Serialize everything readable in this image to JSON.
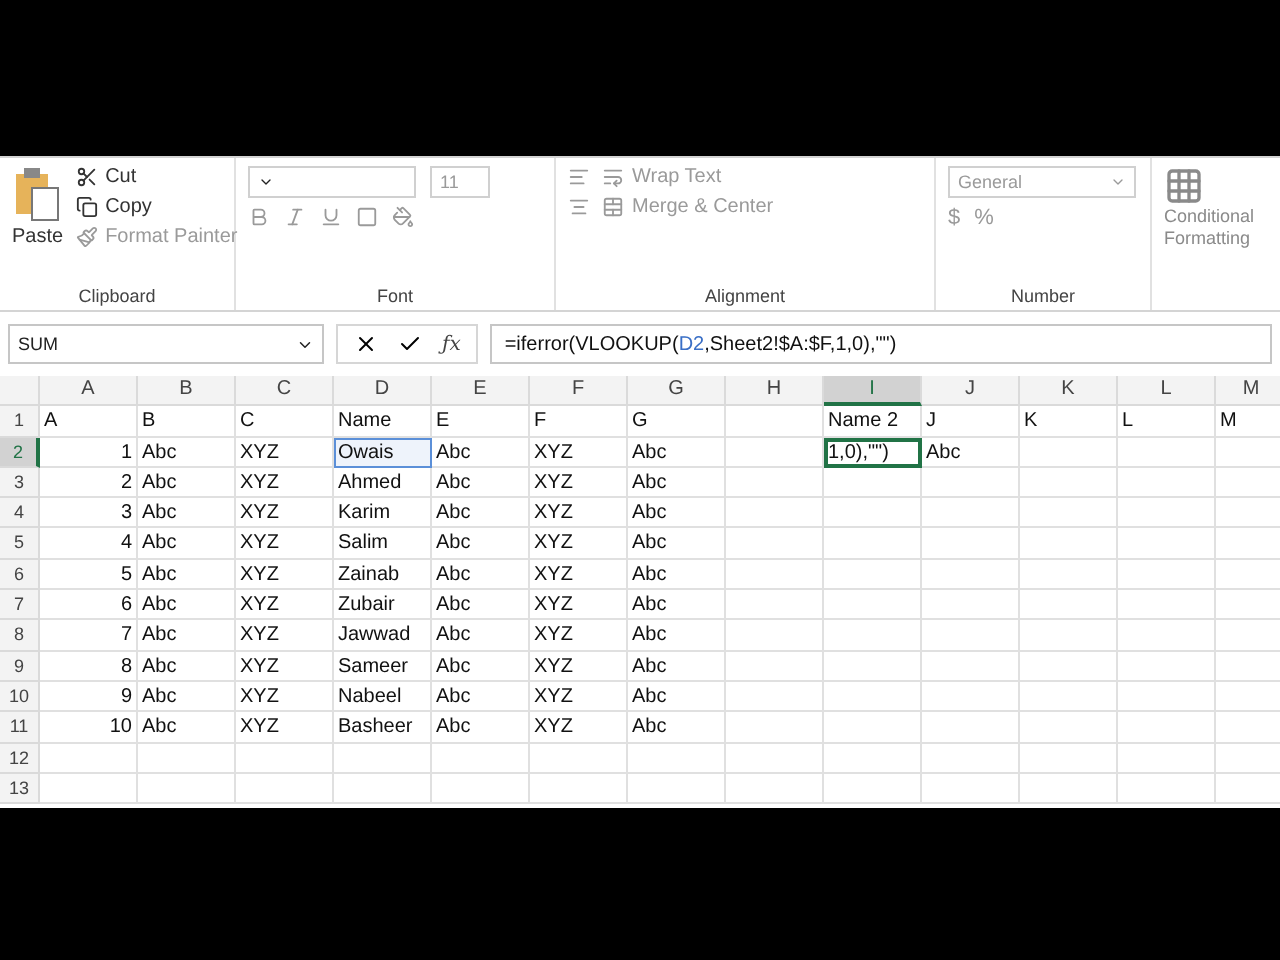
{
  "ribbon": {
    "groups": [
      {
        "kind": "clipboard",
        "label": "Clipboard",
        "paste": {
          "label": "Paste",
          "disabled": false
        },
        "items": [
          {
            "label": "Cut",
            "disabled": false
          },
          {
            "label": "Copy",
            "disabled": false
          },
          {
            "label": "Format Painter",
            "disabled": true
          }
        ]
      },
      {
        "kind": "font",
        "label": "Font",
        "font_size": "11",
        "disabled": true
      },
      {
        "kind": "alignment",
        "label": "Alignment",
        "items": [
          {
            "label": "Wrap Text",
            "disabled": true
          },
          {
            "label": "Merge & Center",
            "disabled": true
          }
        ]
      },
      {
        "kind": "number",
        "label": "Number",
        "format": "General",
        "symbols": [
          "$",
          "%"
        ],
        "disabled": true
      },
      {
        "kind": "styles",
        "items": [
          {
            "label": "Conditional"
          },
          {
            "label": "Formatting"
          }
        ]
      }
    ]
  },
  "formula_bar": {
    "name_box": "SUM",
    "function_symbol": "ƒx",
    "formula": [
      {
        "text": "=iferror(VLOOKUP(",
        "kind": "plain"
      },
      {
        "text": "D2",
        "kind": "ref"
      },
      {
        "text": ",Sheet2!$A:$F,1,0),\"\")",
        "kind": "plain"
      }
    ]
  },
  "sheet": {
    "columns": [
      {
        "label": "A",
        "selected": false
      },
      {
        "label": "B",
        "selected": false
      },
      {
        "label": "C",
        "selected": false
      },
      {
        "label": "D",
        "selected": false
      },
      {
        "label": "E",
        "selected": false
      },
      {
        "label": "F",
        "selected": false
      },
      {
        "label": "G",
        "selected": false
      },
      {
        "label": "H",
        "selected": false
      },
      {
        "label": "I",
        "selected": true
      },
      {
        "label": "J",
        "selected": false
      },
      {
        "label": "K",
        "selected": false
      },
      {
        "label": "L",
        "selected": false
      },
      {
        "label": "M",
        "selected": false
      }
    ],
    "rows": [
      {
        "number": "1",
        "selected": false,
        "cells": [
          {
            "text": "A",
            "referenced": false,
            "editing": false
          },
          {
            "text": "B",
            "referenced": false,
            "editing": false
          },
          {
            "text": "C",
            "referenced": false,
            "editing": false
          },
          {
            "text": "Name",
            "referenced": false,
            "editing": false
          },
          {
            "text": "E",
            "referenced": false,
            "editing": false
          },
          {
            "text": "F",
            "referenced": false,
            "editing": false
          },
          {
            "text": "G",
            "referenced": false,
            "editing": false
          },
          {
            "text": "",
            "referenced": false,
            "editing": false
          },
          {
            "text": "Name 2",
            "referenced": false,
            "editing": false
          },
          {
            "text": "J",
            "referenced": false,
            "editing": false
          },
          {
            "text": "K",
            "referenced": false,
            "editing": false
          },
          {
            "text": "L",
            "referenced": false,
            "editing": false
          },
          {
            "text": "M",
            "referenced": false,
            "editing": false
          }
        ]
      },
      {
        "number": "2",
        "selected": true,
        "cells": [
          {
            "text": "1",
            "referenced": false,
            "editing": false
          },
          {
            "text": "Abc",
            "referenced": false,
            "editing": false
          },
          {
            "text": "XYZ",
            "referenced": false,
            "editing": false
          },
          {
            "text": "Owais",
            "referenced": true,
            "editing": false
          },
          {
            "text": "Abc",
            "referenced": false,
            "editing": false
          },
          {
            "text": "XYZ",
            "referenced": false,
            "editing": false
          },
          {
            "text": "Abc",
            "referenced": false,
            "editing": false
          },
          {
            "text": "",
            "referenced": false,
            "editing": false
          },
          {
            "text": "1,0),\"\")",
            "referenced": false,
            "editing": true
          },
          {
            "text": "Abc",
            "referenced": false,
            "editing": false
          }
        ]
      },
      {
        "number": "3",
        "selected": false,
        "cells": [
          {
            "text": "2",
            "referenced": false,
            "editing": false
          },
          {
            "text": "Abc",
            "referenced": false,
            "editing": false
          },
          {
            "text": "XYZ",
            "referenced": false,
            "editing": false
          },
          {
            "text": "Ahmed",
            "referenced": false,
            "editing": false
          },
          {
            "text": "Abc",
            "referenced": false,
            "editing": false
          },
          {
            "text": "XYZ",
            "referenced": false,
            "editing": false
          },
          {
            "text": "Abc",
            "referenced": false,
            "editing": false
          }
        ]
      },
      {
        "number": "4",
        "selected": false,
        "cells": [
          {
            "text": "3",
            "referenced": false,
            "editing": false
          },
          {
            "text": "Abc",
            "referenced": false,
            "editing": false
          },
          {
            "text": "XYZ",
            "referenced": false,
            "editing": false
          },
          {
            "text": "Karim",
            "referenced": false,
            "editing": false
          },
          {
            "text": "Abc",
            "referenced": false,
            "editing": false
          },
          {
            "text": "XYZ",
            "referenced": false,
            "editing": false
          },
          {
            "text": "Abc",
            "referenced": false,
            "editing": false
          }
        ]
      },
      {
        "number": "5",
        "selected": false,
        "cells": [
          {
            "text": "4",
            "referenced": false,
            "editing": false
          },
          {
            "text": "Abc",
            "referenced": false,
            "editing": false
          },
          {
            "text": "XYZ",
            "referenced": false,
            "editing": false
          },
          {
            "text": "Salim",
            "referenced": false,
            "editing": false
          },
          {
            "text": "Abc",
            "referenced": false,
            "editing": false
          },
          {
            "text": "XYZ",
            "referenced": false,
            "editing": false
          },
          {
            "text": "Abc",
            "referenced": false,
            "editing": false
          }
        ]
      },
      {
        "number": "6",
        "selected": false,
        "cells": [
          {
            "text": "5",
            "referenced": false,
            "editing": false
          },
          {
            "text": "Abc",
            "referenced": false,
            "editing": false
          },
          {
            "text": "XYZ",
            "referenced": false,
            "editing": false
          },
          {
            "text": "Zainab",
            "referenced": false,
            "editing": false
          },
          {
            "text": "Abc",
            "referenced": false,
            "editing": false
          },
          {
            "text": "XYZ",
            "referenced": false,
            "editing": false
          },
          {
            "text": "Abc",
            "referenced": false,
            "editing": false
          }
        ]
      },
      {
        "number": "7",
        "selected": false,
        "cells": [
          {
            "text": "6",
            "referenced": false,
            "editing": false
          },
          {
            "text": "Abc",
            "referenced": false,
            "editing": false
          },
          {
            "text": "XYZ",
            "referenced": false,
            "editing": false
          },
          {
            "text": "Zubair",
            "referenced": false,
            "editing": false
          },
          {
            "text": "Abc",
            "referenced": false,
            "editing": false
          },
          {
            "text": "XYZ",
            "referenced": false,
            "editing": false
          },
          {
            "text": "Abc",
            "referenced": false,
            "editing": false
          }
        ]
      },
      {
        "number": "8",
        "selected": false,
        "cells": [
          {
            "text": "7",
            "referenced": false,
            "editing": false
          },
          {
            "text": "Abc",
            "referenced": false,
            "editing": false
          },
          {
            "text": "XYZ",
            "referenced": false,
            "editing": false
          },
          {
            "text": "Jawwad",
            "referenced": false,
            "editing": false
          },
          {
            "text": "Abc",
            "referenced": false,
            "editing": false
          },
          {
            "text": "XYZ",
            "referenced": false,
            "editing": false
          },
          {
            "text": "Abc",
            "referenced": false,
            "editing": false
          }
        ]
      },
      {
        "number": "9",
        "selected": false,
        "cells": [
          {
            "text": "8",
            "referenced": false,
            "editing": false
          },
          {
            "text": "Abc",
            "referenced": false,
            "editing": false
          },
          {
            "text": "XYZ",
            "referenced": false,
            "editing": false
          },
          {
            "text": "Sameer",
            "referenced": false,
            "editing": false
          },
          {
            "text": "Abc",
            "referenced": false,
            "editing": false
          },
          {
            "text": "XYZ",
            "referenced": false,
            "editing": false
          },
          {
            "text": "Abc",
            "referenced": false,
            "editing": false
          }
        ]
      },
      {
        "number": "10",
        "selected": false,
        "cells": [
          {
            "text": "9",
            "referenced": false,
            "editing": false
          },
          {
            "text": "Abc",
            "referenced": false,
            "editing": false
          },
          {
            "text": "XYZ",
            "referenced": false,
            "editing": false
          },
          {
            "text": "Nabeel",
            "referenced": false,
            "editing": false
          },
          {
            "text": "Abc",
            "referenced": false,
            "editing": false
          },
          {
            "text": "XYZ",
            "referenced": false,
            "editing": false
          },
          {
            "text": "Abc",
            "referenced": false,
            "editing": false
          }
        ]
      },
      {
        "number": "11",
        "selected": false,
        "cells": [
          {
            "text": "10",
            "referenced": false,
            "editing": false
          },
          {
            "text": "Abc",
            "referenced": false,
            "editing": false
          },
          {
            "text": "XYZ",
            "referenced": false,
            "editing": false
          },
          {
            "text": "Basheer",
            "referenced": false,
            "editing": false
          },
          {
            "text": "Abc",
            "referenced": false,
            "editing": false
          },
          {
            "text": "XYZ",
            "referenced": false,
            "editing": false
          },
          {
            "text": "Abc",
            "referenced": false,
            "editing": false
          }
        ]
      },
      {
        "number": "12",
        "selected": false,
        "cells": []
      },
      {
        "number": "13",
        "selected": false,
        "cells": []
      }
    ]
  }
}
